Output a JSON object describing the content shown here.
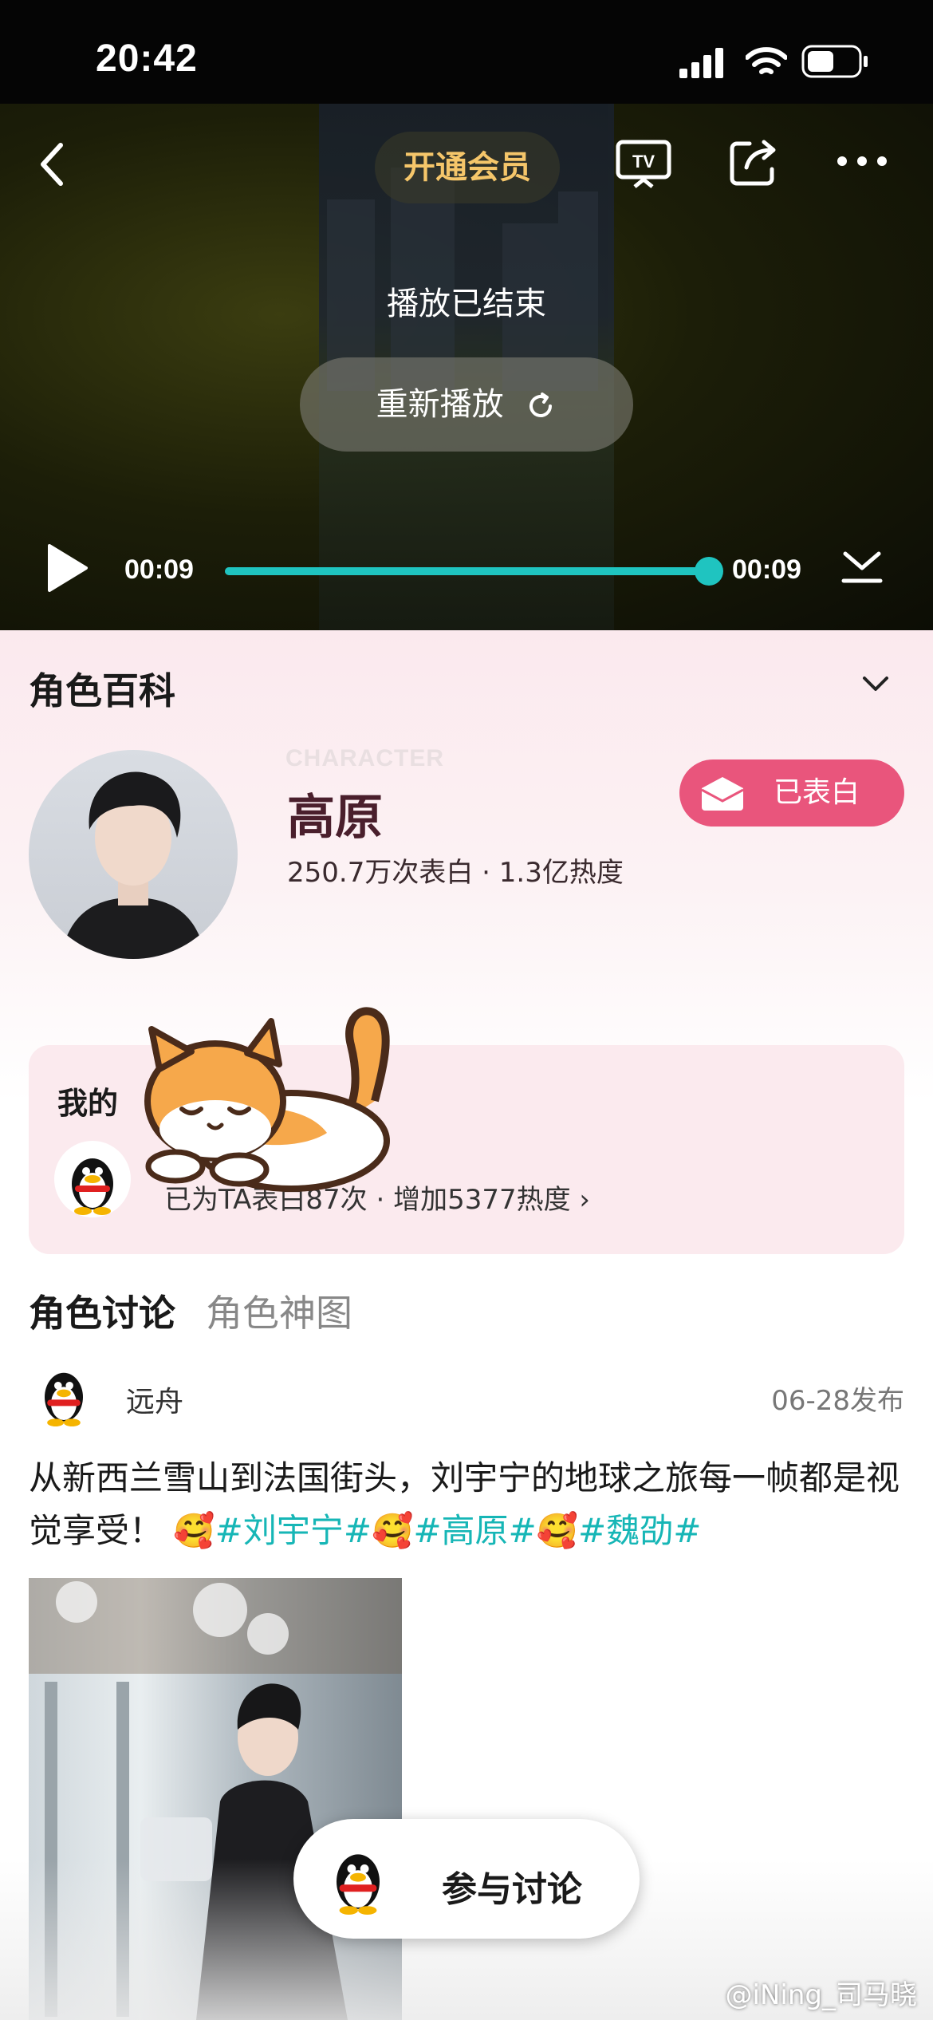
{
  "status_bar": {
    "time": "20:42"
  },
  "player": {
    "vip_label": "开通会员",
    "ended_text": "播放已结束",
    "replay_label": "重新播放",
    "current_time": "00:09",
    "duration": "00:09",
    "progress": 1.0,
    "accent": "#1fc4c0"
  },
  "character": {
    "section_title": "角色百科",
    "tag": "CHARACTER",
    "name": "高原",
    "stats": "250.7万次表白 · 1.3亿热度",
    "confess_label": "已表白",
    "confess_color": "#e9557c"
  },
  "my_card": {
    "title": "我的",
    "summary": "已为TA表白87次 · 增加5377热度"
  },
  "tabs": [
    {
      "label": "角色讨论"
    },
    {
      "label": "角色神图"
    }
  ],
  "post": {
    "username": "远舟",
    "time": "06-28发布",
    "text_prefix": "从新西兰雪山到法国街头，刘宇宁的地球之旅每一帧都是视觉享受！",
    "tags": [
      "#刘宇宁#",
      "#高原#",
      "#魏劭#"
    ],
    "emoji": "🥰"
  },
  "join_button": {
    "label": "参与讨论"
  },
  "watermark": "@iNing_司马晓"
}
